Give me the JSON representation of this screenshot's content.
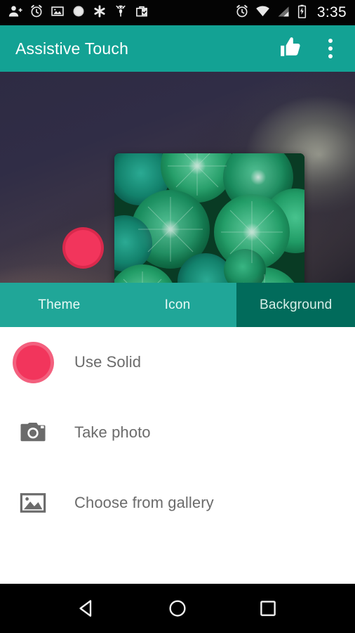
{
  "status_bar": {
    "time": "3:35",
    "left_icons": [
      {
        "name": "add-person-icon"
      },
      {
        "name": "alarm-icon"
      },
      {
        "name": "image-icon"
      },
      {
        "name": "circle-icon"
      },
      {
        "name": "asterisk-icon"
      },
      {
        "name": "bug-icon"
      },
      {
        "name": "briefcase-check-icon"
      }
    ],
    "right_icons": [
      {
        "name": "alarm-icon"
      },
      {
        "name": "wifi-icon"
      },
      {
        "name": "cellular-signal-icon"
      },
      {
        "name": "battery-charging-icon"
      }
    ]
  },
  "app_bar": {
    "title": "Assistive Touch",
    "thumbs_up_label": "thumb-up-icon",
    "overflow_label": "more-options-icon",
    "background_color": "#13a294"
  },
  "preview": {
    "floating_bubble_color": "#f0325a",
    "secondary_bubble_color": "#a02945",
    "card_alt": "green nasturtium leaves photo"
  },
  "tabs": {
    "items": [
      {
        "label": "Theme",
        "selected": false
      },
      {
        "label": "Icon",
        "selected": false
      },
      {
        "label": "Background",
        "selected": true
      }
    ],
    "selected_color": "#016b5b",
    "bar_color": "#20a698"
  },
  "list": {
    "items": [
      {
        "label": "Use Solid",
        "icon": "solid-color-swatch-icon"
      },
      {
        "label": "Take photo",
        "icon": "camera-icon"
      },
      {
        "label": "Choose from gallery",
        "icon": "gallery-image-icon"
      }
    ]
  },
  "nav_bar": {
    "back_label": "back-nav-icon",
    "home_label": "home-nav-icon",
    "recents_label": "recents-nav-icon"
  }
}
